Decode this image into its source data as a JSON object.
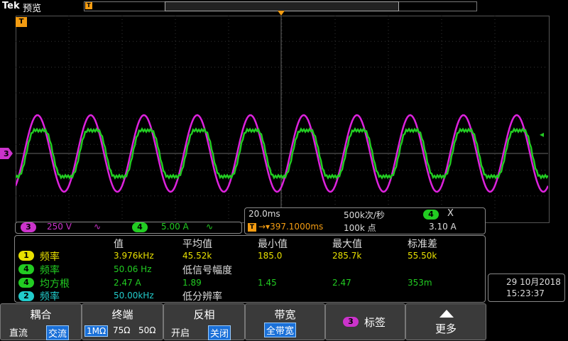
{
  "header": {
    "logo": "Tek",
    "mode": "预览"
  },
  "graticule": {
    "trigger_marker": "T"
  },
  "channels": [
    {
      "id": "3",
      "scale": "250 V",
      "bw_icon": "∿",
      "color": "#cc33cc"
    },
    {
      "id": "4",
      "scale": "5.00 A",
      "bw_icon": "∿",
      "color": "#22cc22"
    }
  ],
  "timebase": {
    "scale": "20.0ms",
    "sample_rate": "500k次/秒",
    "trigger_position": "397.1000ms",
    "record_length": "100k 点",
    "trigger_channel": "4",
    "trigger_type": "X",
    "trigger_level": "3.10 A"
  },
  "measurements": {
    "headers": [
      "值",
      "平均值",
      "最小值",
      "最大值",
      "标准差"
    ],
    "rows": [
      {
        "source": "1",
        "name": "频率",
        "color": "#e8e000",
        "value": "3.976kHz",
        "mean": "45.52k",
        "min": "185.0",
        "max": "285.7k",
        "std": "55.50k"
      },
      {
        "source": "4",
        "name": "频率",
        "color": "#22cc22",
        "value": "50.06 Hz",
        "note": "低信号幅度"
      },
      {
        "source": "4",
        "name": "均方根",
        "color": "#22cc22",
        "value": "2.47 A",
        "mean": "1.89",
        "min": "1.45",
        "max": "2.47",
        "std": "353m"
      },
      {
        "source": "2",
        "name": "频率",
        "color": "#22cccc",
        "value": "50.00kHz",
        "note": "低分辨率"
      }
    ]
  },
  "datetime": {
    "date": "29 10月2018",
    "time": "15:23:37"
  },
  "softkeys": [
    {
      "title": "耦合",
      "options": [
        "直流",
        "交流"
      ],
      "selected": "交流"
    },
    {
      "title": "终端",
      "options": [
        "1MΩ",
        "75Ω",
        "50Ω"
      ],
      "selected": "1MΩ"
    },
    {
      "title": "反相",
      "options": [
        "开启",
        "关闭"
      ],
      "selected": "关闭"
    },
    {
      "title": "带宽",
      "options": [
        "全带宽"
      ],
      "selected": "全带宽"
    },
    {
      "title": "标签",
      "badge": "3"
    },
    {
      "title": "更多",
      "icon": "up-arrow-icon"
    }
  ]
}
